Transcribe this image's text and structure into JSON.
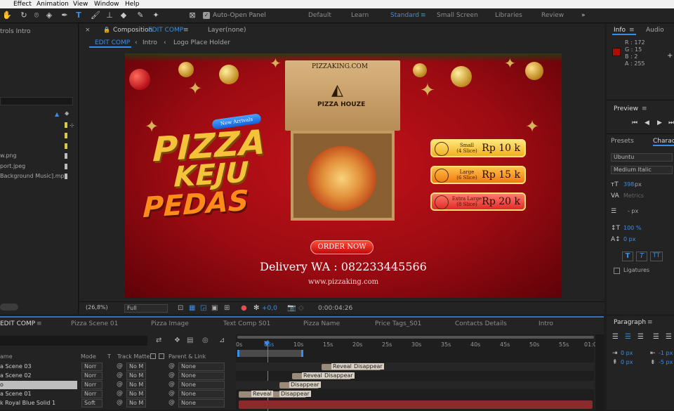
{
  "menu": [
    "Effect",
    "Animation",
    "View",
    "Window",
    "Help"
  ],
  "toolbar": {
    "auto_open_panel": "Auto-Open Panel",
    "workspaces": [
      "Default",
      "Learn",
      "Standard",
      "Small Screen",
      "Libraries",
      "Review"
    ],
    "more": "»"
  },
  "project": {
    "title": "trols Intro",
    "files": [
      "w.png",
      "port.jpeg",
      "Background Music].mp4"
    ]
  },
  "comp": {
    "close": "×",
    "lock": "🔒",
    "label": "Composition",
    "name": "EDIT COMP",
    "menu_icon": "≡",
    "layer_label": "Layer",
    "layer_val": "(none)",
    "nav_active": "EDIT COMP",
    "nav_items": [
      "Intro",
      "Logo Place Holder"
    ],
    "nav_sep": "‹",
    "zoom": "(26,8%)",
    "quality": "Full",
    "exposure": "+0,0",
    "timecode": "0:00:04:26"
  },
  "poster": {
    "site_top": "PIZZAKING.COM",
    "box_brand": "PIZZA HOUZE",
    "badge": "New Arrivals",
    "title1": "PIZZA",
    "title2": "KEJU",
    "title3": "PEDAS",
    "prices": [
      {
        "size": "Small\n(4 Slice)",
        "price": "Rp 10 k"
      },
      {
        "size": "Large\n(6 Slice)",
        "price": "Rp 15 k"
      },
      {
        "size": "Extra Large\n(8 Slice)",
        "price": "Rp 20 k"
      }
    ],
    "order": "ORDER NOW",
    "delivery": "Delivery WA : 082233445566",
    "site": "www.pizzaking.com"
  },
  "info": {
    "tab": "Info",
    "tab2": "Audio",
    "menu_icon": "≡",
    "r": "R : 172",
    "g": "G : 15",
    "b": "B : 2",
    "a": "A : 255",
    "swatch": "#ac0f02"
  },
  "preview": {
    "tab": "Preview",
    "menu_icon": "≡",
    "controls": [
      "⏮",
      "◀",
      "▶",
      "⏭"
    ]
  },
  "character": {
    "tab_presets": "Presets",
    "tab_char": "Characte",
    "font": "Ubuntu",
    "style": "Medium Italic",
    "size": "398",
    "size_unit": "px",
    "metrics": "Metrics",
    "leading": "- px",
    "scale": "100 %",
    "baseline": "0 px",
    "ligatures": "Ligatures"
  },
  "paragraph": {
    "tab": "Paragraph",
    "menu_icon": "≡",
    "v1": "0 px",
    "v2": "0 px",
    "v3": "-1 px",
    "v4": "-5 px"
  },
  "timeline": {
    "tabs": [
      "EDIT COMP",
      "Pizza Scene 01",
      "Pizza Image",
      "Text Comp S01",
      "Pizza Name",
      "Price Tags_S01",
      "Contacts Details",
      "Intro"
    ],
    "cols": {
      "name": "ame",
      "mode": "Mode",
      "t": "T",
      "matte": "Track Matte",
      "parent": "Parent & Link"
    },
    "ticks": [
      "0s",
      "05s",
      "10s",
      "15s",
      "20s",
      "25s",
      "30s",
      "35s",
      "40s",
      "45s",
      "50s",
      "55s",
      "01:0"
    ],
    "layers": [
      {
        "name": "a Scene 03",
        "mode": "Norr",
        "matte": "No M",
        "parent": "None"
      },
      {
        "name": "a Scene 02",
        "mode": "Norr",
        "matte": "No M",
        "parent": "None"
      },
      {
        "name": "o",
        "mode": "Norr",
        "matte": "No M",
        "parent": "None"
      },
      {
        "name": "a Scene 01",
        "mode": "Norr",
        "matte": "No M",
        "parent": "None"
      },
      {
        "name": "k Royal Blue Solid 1",
        "mode": "Soft",
        "matte": "No M",
        "parent": "None"
      }
    ],
    "bars": {
      "reveal": "Reveal",
      "disappear": "Disappear"
    }
  }
}
